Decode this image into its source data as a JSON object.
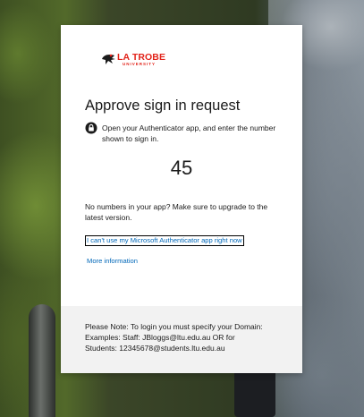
{
  "logo": {
    "name": "LA TROBE",
    "sub": "UNIVERSITY",
    "color": "#e2231a"
  },
  "title": "Approve sign in request",
  "instruction": {
    "icon": "authenticator-lock-icon",
    "text": "Open your Authenticator app, and enter the number shown to sign in."
  },
  "number": "45",
  "note": "No numbers in your app? Make sure to upgrade to the latest version.",
  "links": {
    "cant_use": "I can't use my Microsoft Authenticator app right now",
    "more_info": "More information",
    "color": "#0067b8"
  },
  "footer": {
    "line1": "Please Note: To login you must specify your Domain:",
    "line2": "Examples: Staff: JBloggs@ltu.edu.au OR for",
    "line3": "Students: 12345678@students.ltu.edu.au"
  }
}
